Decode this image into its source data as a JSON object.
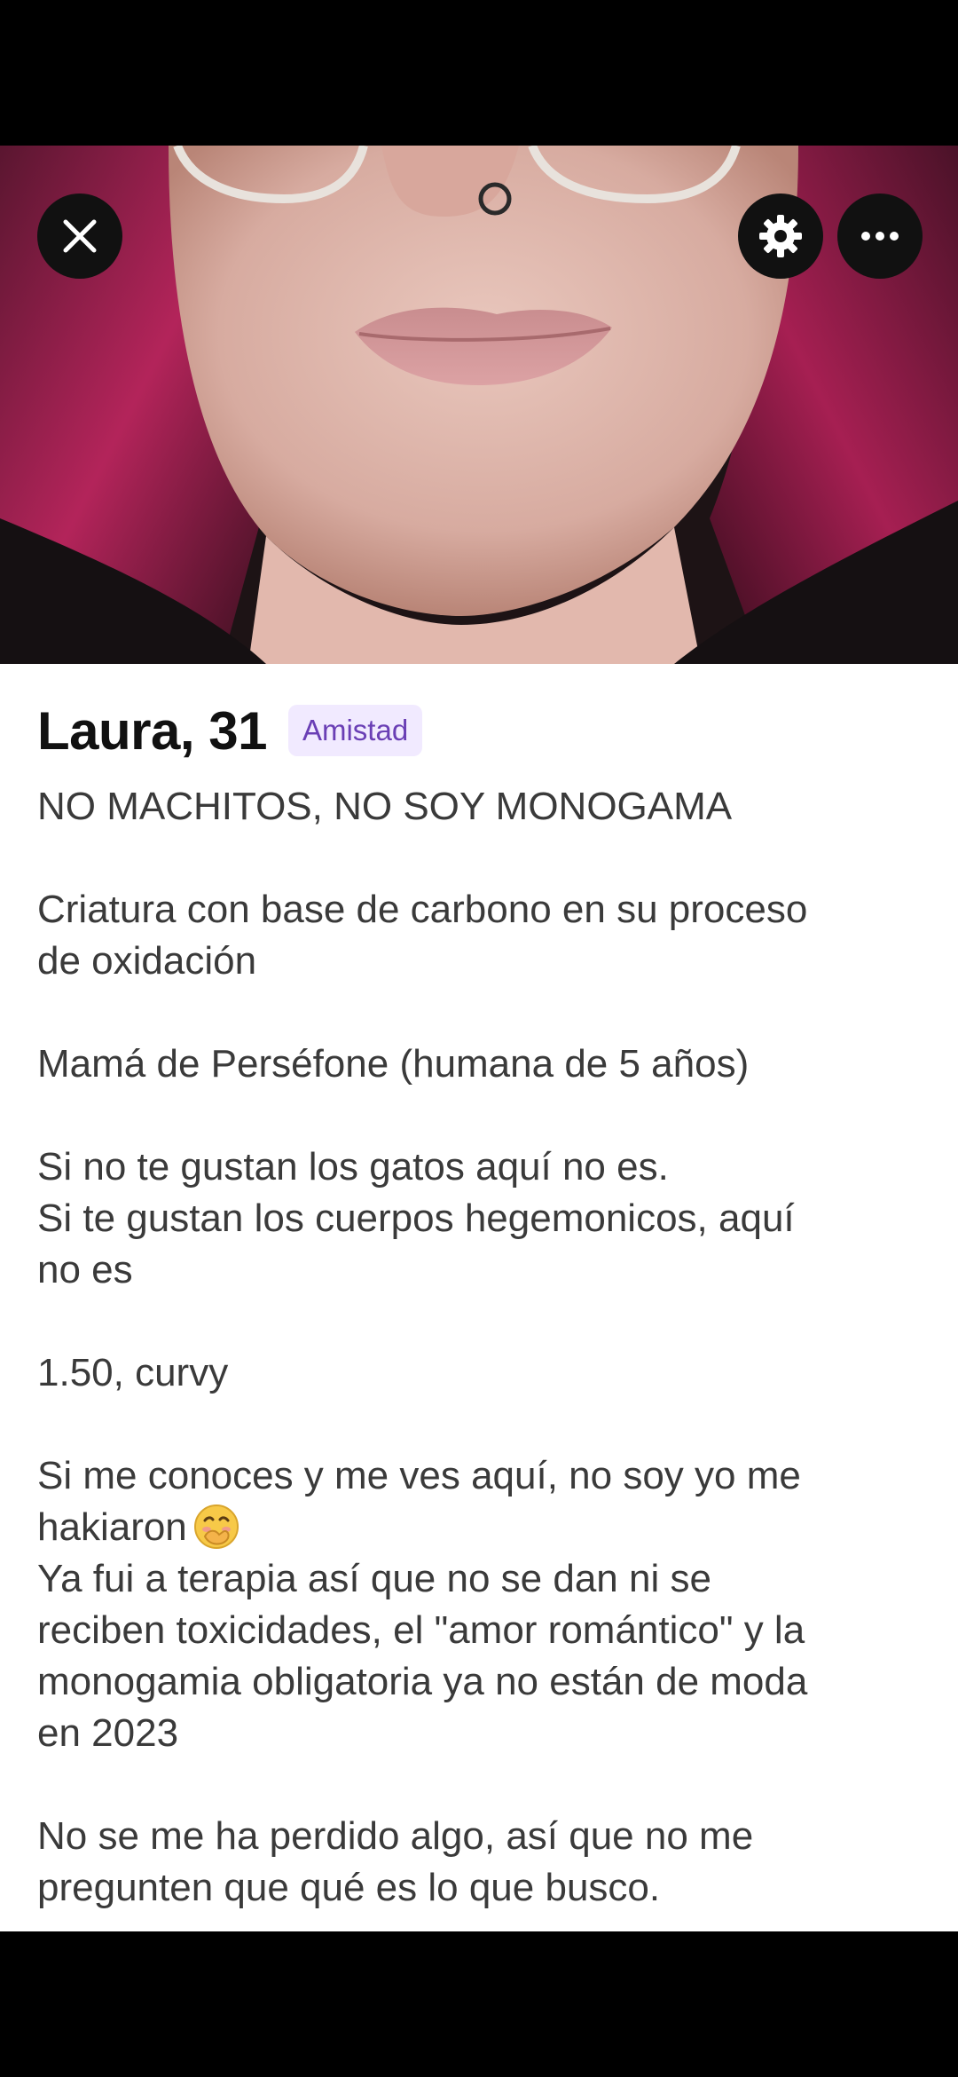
{
  "profile": {
    "name_age": "Laura, 31",
    "badge": "Amistad"
  },
  "bio": {
    "line1": "NO MACHITOS, NO SOY MONOGAMA",
    "line2": "Criatura con base de carbono en su proceso",
    "line3": "de oxidación",
    "line4": "Mamá de Perséfone (humana de 5 años)",
    "line5": "Si no te gustan los gatos aquí no es.",
    "line6": "Si te gustan los cuerpos hegemonicos, aquí",
    "line7": "no es",
    "line8": "1.50, curvy",
    "line9": "Si me conoces y me ves aquí, no soy yo me",
    "line10": "hakiaron",
    "line11": "Ya fui a terapia así que no se dan ni se",
    "line12": "reciben toxicidades, el \"amor romántico\" y la",
    "line13": "monogamia obligatoria ya no están de moda",
    "line14": "en 2023",
    "line15": "No se me ha perdido algo, así que no me",
    "line16": "pregunten que qué es lo que busco."
  },
  "icons": {
    "close": "close-icon",
    "settings": "gear-icon",
    "more": "more-icon",
    "emoji": "hand-over-mouth-emoji"
  },
  "colors": {
    "badge_bg": "#f1eaff",
    "badge_text": "#6a3fb5",
    "hair": "#a5224f"
  }
}
